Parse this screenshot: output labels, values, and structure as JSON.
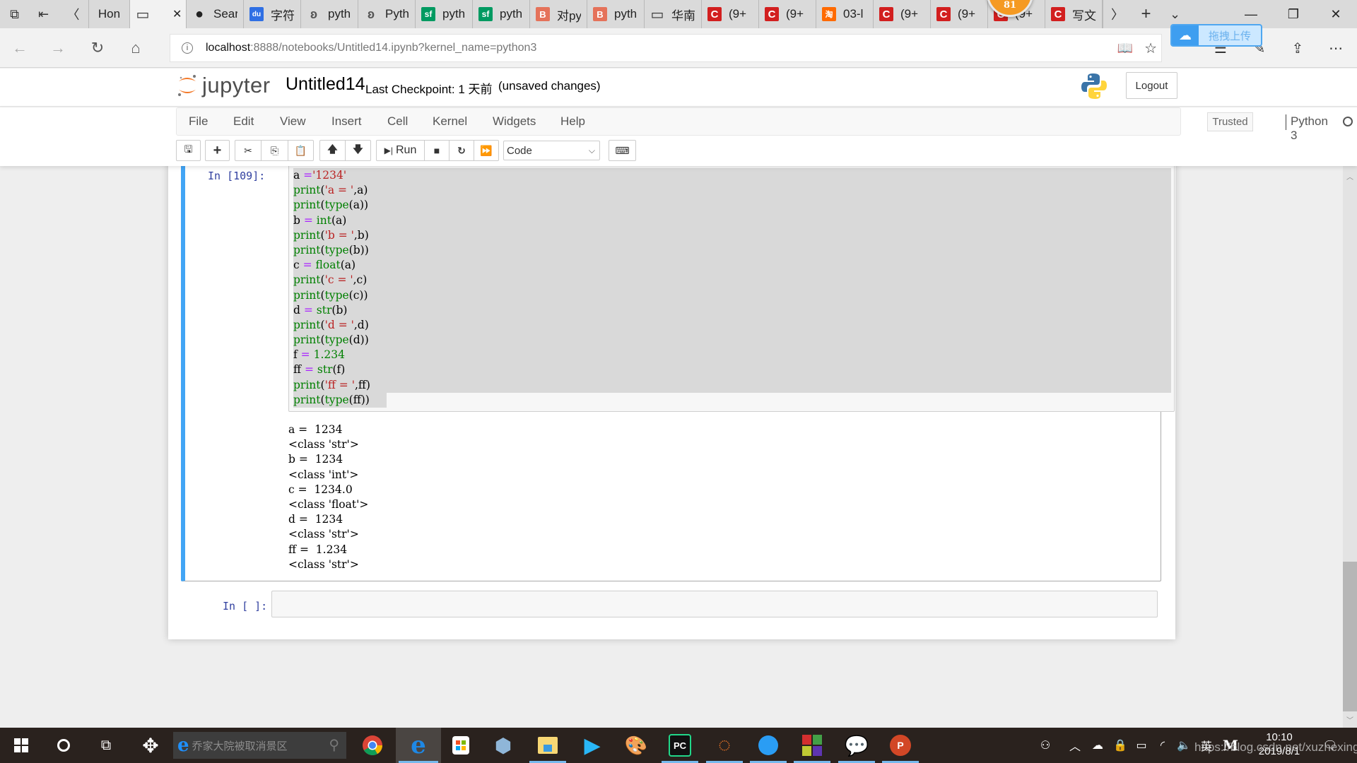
{
  "browser": {
    "tabs": [
      {
        "label": "Hon",
        "icon": "home-page-icon"
      },
      {
        "label": "",
        "icon": "blank-page-icon",
        "active": true
      },
      {
        "label": "Sear",
        "icon": "github-icon"
      },
      {
        "label": "字符",
        "icon": "baidu-icon"
      },
      {
        "label": "pyth",
        "icon": "bird-icon"
      },
      {
        "label": "Pyth",
        "icon": "bird-icon"
      },
      {
        "label": "pyth",
        "icon": "segmentfault-icon"
      },
      {
        "label": "pyth",
        "icon": "segmentfault-icon"
      },
      {
        "label": "对py",
        "icon": "jb-icon"
      },
      {
        "label": "pyth",
        "icon": "jb-icon"
      },
      {
        "label": "华南",
        "icon": "blank-page-icon"
      },
      {
        "label": "(9+",
        "icon": "csdn-icon"
      },
      {
        "label": "(9+",
        "icon": "csdn-icon"
      },
      {
        "label": "03-l",
        "icon": "taobao-icon"
      },
      {
        "label": "(9+",
        "icon": "csdn-icon"
      },
      {
        "label": "(9+",
        "icon": "csdn-icon"
      },
      {
        "label": "(9+",
        "icon": "csdn-icon"
      },
      {
        "label": "写文",
        "icon": "csdn-icon"
      }
    ],
    "notification_badge": "81",
    "url_host": "localhost",
    "url_rest": ":8888/notebooks/Untitled14.ipynb?kernel_name=python3",
    "upload_widget_label": "拖拽上传"
  },
  "jupyter": {
    "logo_text": "jupyter",
    "notebook_title": "Untitled14",
    "checkpoint": "Last Checkpoint: 1 天前",
    "unsaved": "(unsaved changes)",
    "logout_label": "Logout",
    "menu": [
      "File",
      "Edit",
      "View",
      "Insert",
      "Cell",
      "Kernel",
      "Widgets",
      "Help"
    ],
    "trusted_label": "Trusted",
    "kernel_name": "Python 3",
    "toolbar": {
      "run_label": "Run",
      "cell_type": "Code"
    }
  },
  "cells": [
    {
      "prompt": "In [109]:",
      "code_lines": [
        [
          [
            "n",
            "a "
          ],
          [
            "o",
            "="
          ],
          [
            "s",
            "'1234'"
          ]
        ],
        [
          [
            "k",
            "print"
          ],
          [
            "n",
            "("
          ],
          [
            "s",
            "'a = '"
          ],
          [
            "n",
            ",a)"
          ]
        ],
        [
          [
            "k",
            "print"
          ],
          [
            "n",
            "("
          ],
          [
            "k",
            "type"
          ],
          [
            "n",
            "(a))"
          ]
        ],
        [
          [
            "n",
            "b "
          ],
          [
            "o",
            "="
          ],
          [
            "n",
            " "
          ],
          [
            "k",
            "int"
          ],
          [
            "n",
            "(a)"
          ]
        ],
        [
          [
            "k",
            "print"
          ],
          [
            "n",
            "("
          ],
          [
            "s",
            "'b = '"
          ],
          [
            "n",
            ",b)"
          ]
        ],
        [
          [
            "k",
            "print"
          ],
          [
            "n",
            "("
          ],
          [
            "k",
            "type"
          ],
          [
            "n",
            "(b))"
          ]
        ],
        [
          [
            "n",
            "c "
          ],
          [
            "o",
            "="
          ],
          [
            "n",
            " "
          ],
          [
            "k",
            "float"
          ],
          [
            "n",
            "(a)"
          ]
        ],
        [
          [
            "k",
            "print"
          ],
          [
            "n",
            "("
          ],
          [
            "s",
            "'c = '"
          ],
          [
            "n",
            ",c)"
          ]
        ],
        [
          [
            "k",
            "print"
          ],
          [
            "n",
            "("
          ],
          [
            "k",
            "type"
          ],
          [
            "n",
            "(c))"
          ]
        ],
        [
          [
            "n",
            "d "
          ],
          [
            "o",
            "="
          ],
          [
            "n",
            " "
          ],
          [
            "k",
            "str"
          ],
          [
            "n",
            "(b)"
          ]
        ],
        [
          [
            "k",
            "print"
          ],
          [
            "n",
            "("
          ],
          [
            "s",
            "'d = '"
          ],
          [
            "n",
            ",d)"
          ]
        ],
        [
          [
            "k",
            "print"
          ],
          [
            "n",
            "("
          ],
          [
            "k",
            "type"
          ],
          [
            "n",
            "(d))"
          ]
        ],
        [
          [
            "n",
            "f "
          ],
          [
            "o",
            "="
          ],
          [
            "n",
            " "
          ],
          [
            "num",
            "1.234"
          ]
        ],
        [
          [
            "n",
            "ff "
          ],
          [
            "o",
            "="
          ],
          [
            "n",
            " "
          ],
          [
            "k",
            "str"
          ],
          [
            "n",
            "(f)"
          ]
        ],
        [
          [
            "k",
            "print"
          ],
          [
            "n",
            "("
          ],
          [
            "s",
            "'ff = '"
          ],
          [
            "n",
            ",ff)"
          ]
        ],
        [
          [
            "k",
            "print"
          ],
          [
            "n",
            "("
          ],
          [
            "k",
            "type"
          ],
          [
            "n",
            "(ff))"
          ]
        ]
      ],
      "output_lines": [
        "a =  1234",
        "<class 'str'>",
        "b =  1234",
        "<class 'int'>",
        "c =  1234.0",
        "<class 'float'>",
        "d =  1234",
        "<class 'str'>",
        "ff =  1.234",
        "<class 'str'>"
      ]
    },
    {
      "prompt": "In [ ]:",
      "code_lines": []
    }
  ],
  "taskbar": {
    "search_text": "乔家大院被取消景区",
    "clock_time": "10:10",
    "clock_date": "2019/8/1",
    "ime_label": "英",
    "notification_count": "1"
  },
  "watermark": "https://blog.csdn.net/xuzhexing",
  "colors": {
    "selected_cell_border": "#42a5f5",
    "prompt": "#303f9f",
    "keyword": "#008000",
    "string": "#ba2121",
    "operator": "#aa22ff",
    "taskbar_bg": "#2a221e"
  }
}
